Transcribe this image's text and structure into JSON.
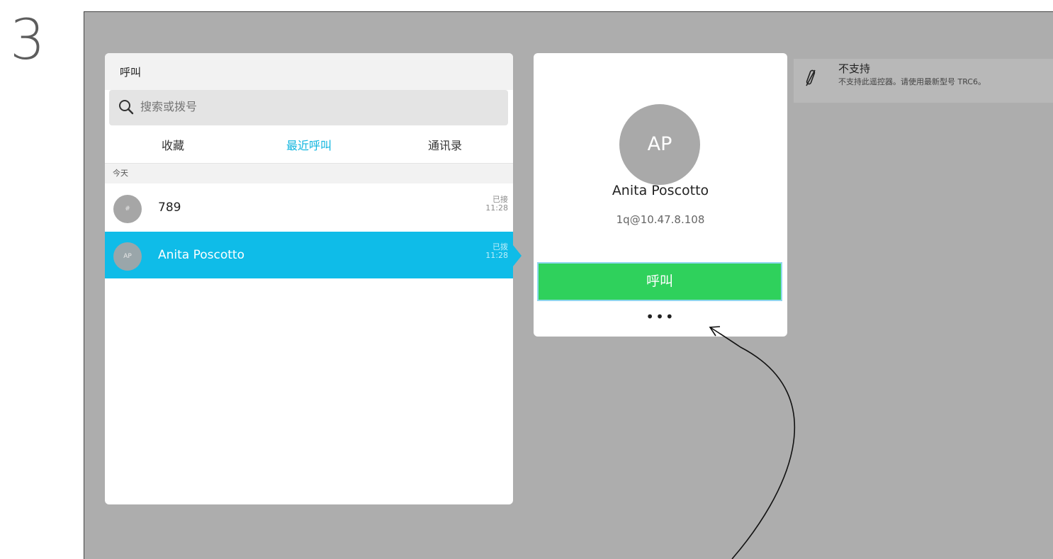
{
  "step_number": "3",
  "call_panel": {
    "title": "呼叫",
    "search": {
      "placeholder": "搜索或拨号"
    },
    "tabs": [
      {
        "label": "收藏",
        "active": false
      },
      {
        "label": "最近呼叫",
        "active": true
      },
      {
        "label": "通讯录",
        "active": false
      }
    ],
    "section_label": "今天",
    "recent_calls": [
      {
        "avatar": "#",
        "name": "789",
        "status": "已接",
        "time": "11:28",
        "selected": false
      },
      {
        "avatar": "AP",
        "name": "Anita Poscotto",
        "status": "已拨",
        "time": "11:28",
        "selected": true
      }
    ]
  },
  "detail_card": {
    "avatar_initials": "AP",
    "name": "Anita Poscotto",
    "address": "1q@10.47.8.108",
    "call_button_label": "呼叫",
    "more_label": "•••"
  },
  "notice": {
    "icon": "remote-unsupported-icon",
    "title": "不支持",
    "text": "不支持此遥控器。请使用最新型号 TRC6。"
  },
  "colors": {
    "screen_bg": "#adadad",
    "accent": "#0fbce8",
    "active_tab": "#0fb5df",
    "call_button": "#2fd15c"
  }
}
